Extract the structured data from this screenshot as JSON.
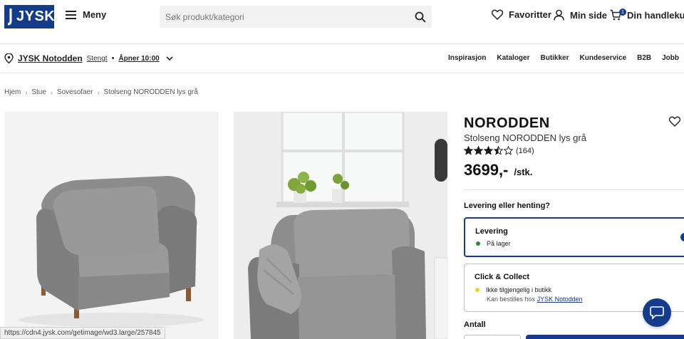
{
  "header": {
    "logo_text": "JYSK",
    "menu_label": "Meny",
    "search_placeholder": "Søk produkt/kategori",
    "favorites_label": "Favoritter",
    "account_label": "Min side",
    "cart_label": "Din handlekurv",
    "cart_count": "1"
  },
  "store": {
    "name": "JYSK Notodden",
    "status": "Stengt",
    "separator": "•",
    "opens": "Åpner 10:00"
  },
  "topnav": [
    "Inspirasjon",
    "Kataloger",
    "Butikker",
    "Kundeservice",
    "B2B",
    "Jobb"
  ],
  "breadcrumb": [
    "Hjem",
    "Stue",
    "Sovesofaer",
    "Stolseng NORODDEN lys grå"
  ],
  "product": {
    "brand": "NORODDEN",
    "name": "Stolseng NORODDEN lys grå",
    "rating": 3.5,
    "rating_max": 5,
    "review_count": "(164)",
    "price": "3699,-",
    "unit": "/stk."
  },
  "delivery": {
    "question": "Levering eller henting?",
    "options": [
      {
        "title": "Levering",
        "status": "På lager",
        "status_color": "#2e8b3e"
      },
      {
        "title": "Click & Collect",
        "status": "Ikke tilgjengelig i butikk",
        "status_color": "#f2d21b",
        "sub_prefix": "Kan bestilles hos",
        "sub_link": "JYSK Notodden"
      }
    ]
  },
  "quantity_label": "Antall",
  "status_url": "https://cdn4.jysk.com/getimage/wd3.large/257845",
  "colors": {
    "brand_blue": "#143c8a",
    "in_stock": "#2e8b3e",
    "unavailable": "#f2d21b"
  }
}
